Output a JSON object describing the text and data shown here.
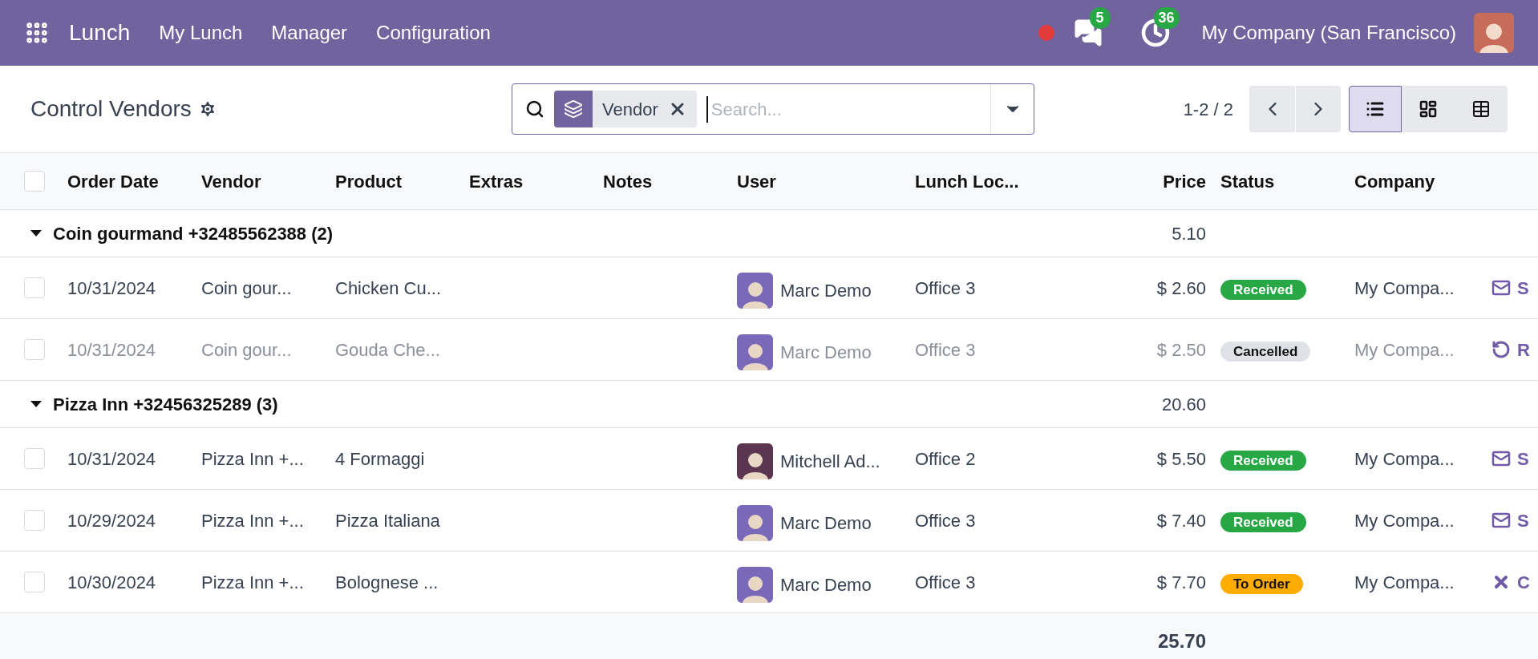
{
  "navbar": {
    "app_name": "Lunch",
    "menu": [
      "My Lunch",
      "Manager",
      "Configuration"
    ],
    "messages_count": "5",
    "activities_count": "36",
    "company": "My Company (San Francisco)"
  },
  "control_panel": {
    "title": "Control Vendors",
    "facet": "Vendor",
    "placeholder": "Search...",
    "pager": "1-2 / 2",
    "views": [
      {
        "kind": "list",
        "selected": true
      },
      {
        "kind": "kanban",
        "selected": false
      },
      {
        "kind": "pivot",
        "selected": false
      }
    ]
  },
  "table": {
    "select_all_checked": false,
    "columns": [
      "Order Date",
      "Vendor",
      "Product",
      "Extras",
      "Notes",
      "User",
      "Lunch Loc...",
      "Price",
      "Status",
      "Company"
    ],
    "groups": [
      {
        "title": "Coin gourmand +32485562388 (2)",
        "expanded": true,
        "subtotal": "5.10",
        "rows": [
          {
            "checked": false,
            "muted": false,
            "order_date": "10/31/2024",
            "vendor": "Coin gour...",
            "product": "Chicken Cu...",
            "user": "Marc Demo",
            "color": "#7a68b8",
            "location": "Office 3",
            "price": "$ 2.60",
            "status": {
              "kind": "received",
              "label": "Received"
            },
            "company": "My Compa...",
            "action": {
              "kind": "send",
              "label": "S"
            }
          },
          {
            "checked": false,
            "muted": true,
            "order_date": "10/31/2024",
            "vendor": "Coin gour...",
            "product": "Gouda Che...",
            "user": "Marc Demo",
            "color": "#7a68b8",
            "location": "Office 3",
            "price": "$ 2.50",
            "status": {
              "kind": "cancelled",
              "label": "Cancelled"
            },
            "company": "My Compa...",
            "action": {
              "kind": "reset",
              "label": "R"
            }
          }
        ]
      },
      {
        "title": "Pizza Inn +32456325289 (3)",
        "expanded": true,
        "subtotal": "20.60",
        "rows": [
          {
            "checked": false,
            "muted": false,
            "order_date": "10/31/2024",
            "vendor": "Pizza Inn +...",
            "product": "4 Formaggi",
            "user": "Mitchell Ad...",
            "color": "#5c3650",
            "location": "Office 2",
            "price": "$ 5.50",
            "status": {
              "kind": "received",
              "label": "Received"
            },
            "company": "My Compa...",
            "action": {
              "kind": "send",
              "label": "S"
            }
          },
          {
            "checked": false,
            "muted": false,
            "order_date": "10/29/2024",
            "vendor": "Pizza Inn +...",
            "product": "Pizza Italiana",
            "user": "Marc Demo",
            "color": "#7a68b8",
            "location": "Office 3",
            "price": "$ 7.40",
            "status": {
              "kind": "received",
              "label": "Received"
            },
            "company": "My Compa...",
            "action": {
              "kind": "send",
              "label": "S"
            }
          },
          {
            "checked": false,
            "muted": false,
            "order_date": "10/30/2024",
            "vendor": "Pizza Inn +...",
            "product": "Bolognese ...",
            "user": "Marc Demo",
            "color": "#7a68b8",
            "location": "Office 3",
            "price": "$ 7.70",
            "status": {
              "kind": "to_order",
              "label": "To Order"
            },
            "company": "My Compa...",
            "action": {
              "kind": "cancel",
              "label": "C"
            }
          }
        ]
      }
    ],
    "total": "25.70"
  }
}
